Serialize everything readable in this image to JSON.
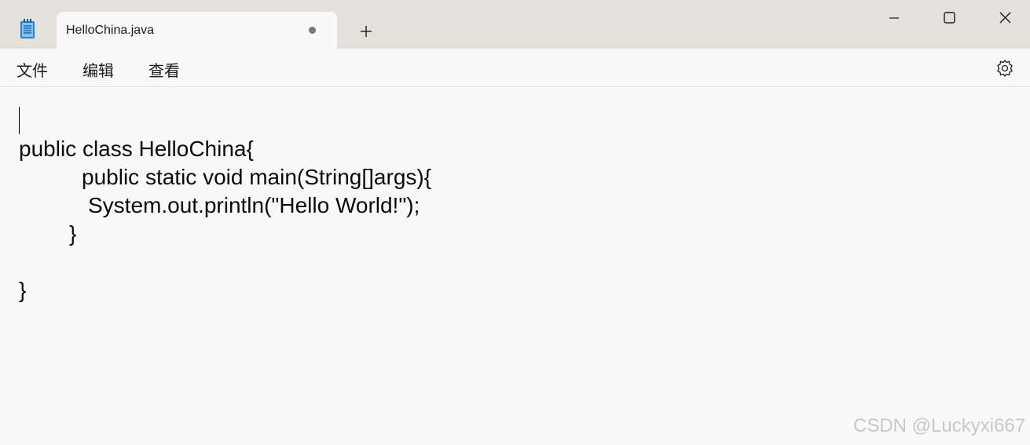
{
  "tab": {
    "title": "HelloChina.java"
  },
  "menu": {
    "file": "文件",
    "edit": "编辑",
    "view": "查看"
  },
  "editor": {
    "lines": [
      "public class HelloChina{",
      "public static void main(String[]args){",
      "System.out.println(\"Hello World!\");",
      "}",
      "}"
    ]
  },
  "watermark": "CSDN @Luckyxi667",
  "icons": {
    "app": "notepad-icon",
    "new_tab": "plus-icon",
    "minimize": "minimize-icon",
    "maximize": "maximize-icon",
    "close": "close-icon",
    "settings": "gear-icon"
  },
  "colors": {
    "titlebar": "#e4e0da",
    "editor_bg": "#f9f9f9",
    "text": "#0a0a0a"
  }
}
